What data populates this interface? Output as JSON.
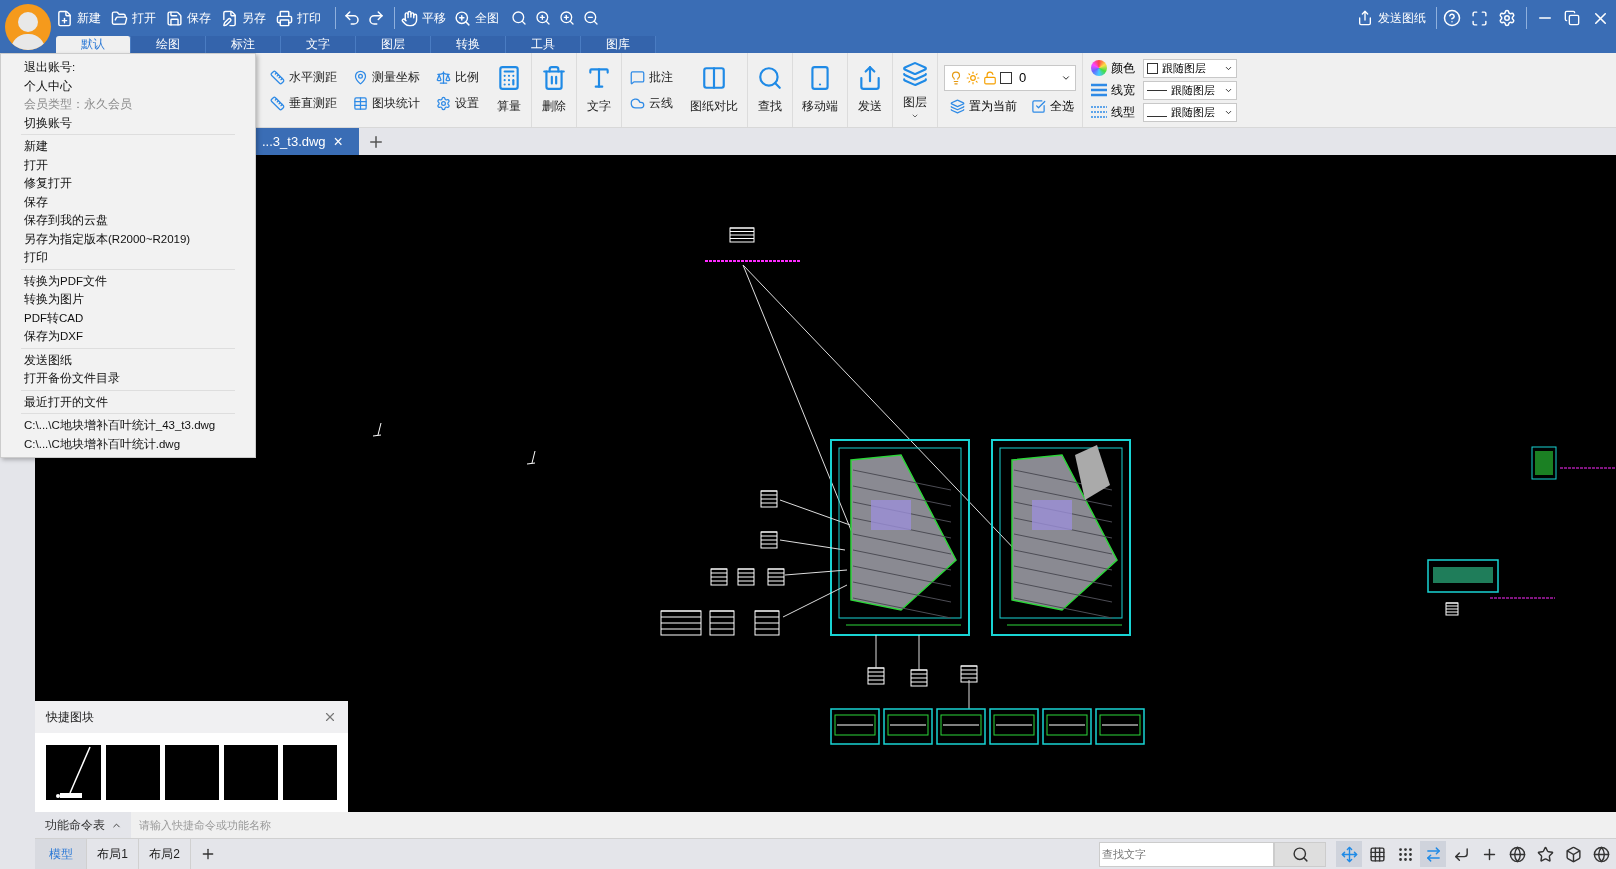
{
  "toolbar": {
    "actions": [
      {
        "label": "新建"
      },
      {
        "label": "打开"
      },
      {
        "label": "保存"
      },
      {
        "label": "另存"
      },
      {
        "label": "打印"
      }
    ],
    "view_actions": [
      {
        "label": "平移"
      },
      {
        "label": "全图"
      }
    ],
    "send_button": "发送图纸"
  },
  "ribbon_tabs": [
    {
      "label": "默认",
      "selected": true
    },
    {
      "label": "绘图",
      "selected": false
    },
    {
      "label": "标注",
      "selected": false
    },
    {
      "label": "文字",
      "selected": false
    },
    {
      "label": "图层",
      "selected": false
    },
    {
      "label": "转换",
      "selected": false
    },
    {
      "label": "工具",
      "selected": false
    },
    {
      "label": "图库",
      "selected": false
    }
  ],
  "ribbon": [
    {
      "kind": "pair",
      "items": [
        "水平测距",
        "垂直测距"
      ]
    },
    {
      "kind": "pair",
      "items": [
        "测量坐标",
        "图块统计"
      ]
    },
    {
      "kind": "pair",
      "items": [
        "比例",
        "设置"
      ]
    },
    {
      "kind": "large",
      "label": "算量"
    },
    {
      "kind": "large",
      "label": "删除"
    },
    {
      "kind": "large",
      "label": "文字"
    },
    {
      "kind": "pair",
      "items": [
        "批注",
        "云线"
      ]
    },
    {
      "kind": "large",
      "label": "图纸对比"
    },
    {
      "kind": "large",
      "label": "查找"
    },
    {
      "kind": "large",
      "label": "移动端"
    },
    {
      "kind": "large",
      "label": "发送"
    },
    {
      "kind": "large",
      "label": "图层"
    },
    {
      "kind": "layer",
      "value": "0",
      "actions": [
        "置为当前",
        "全选"
      ]
    },
    {
      "kind": "props",
      "items": [
        {
          "label": "颜色",
          "value": "跟随图层"
        },
        {
          "label": "线宽",
          "value": "跟随图层"
        },
        {
          "label": "线型",
          "value": "跟随图层"
        }
      ]
    }
  ],
  "file_menu": [
    [
      {
        "label": "退出账号:",
        "disabled": false
      },
      {
        "label": "个人中心",
        "disabled": false
      },
      {
        "label": "会员类型：永久会员",
        "disabled": true
      },
      {
        "label": "切换账号",
        "disabled": false
      }
    ],
    [
      {
        "label": "新建",
        "disabled": false
      },
      {
        "label": "打开",
        "disabled": false
      },
      {
        "label": "修复打开",
        "disabled": false
      },
      {
        "label": "保存",
        "disabled": false
      },
      {
        "label": "保存到我的云盘",
        "disabled": false
      },
      {
        "label": "另存为指定版本(R2000~R2019)",
        "disabled": false
      },
      {
        "label": "打印",
        "disabled": false
      }
    ],
    [
      {
        "label": "转换为PDF文件",
        "disabled": false
      },
      {
        "label": "转换为图片",
        "disabled": false
      },
      {
        "label": "PDF转CAD",
        "disabled": false
      },
      {
        "label": "保存为DXF",
        "disabled": false
      }
    ],
    [
      {
        "label": "发送图纸",
        "disabled": false
      },
      {
        "label": "打开备份文件目录",
        "disabled": false
      }
    ],
    [
      {
        "label": "最近打开的文件",
        "disabled": false
      }
    ],
    [
      {
        "label": "C:\\...\\C地块增补百叶统计_43_t3.dwg",
        "disabled": false
      },
      {
        "label": "C:\\...\\C地块增补百叶统计.dwg",
        "disabled": false
      }
    ]
  ],
  "document_tab": {
    "label": "...3_t3.dwg",
    "close": "×"
  },
  "quick_blocks": {
    "title": "快捷图块",
    "thumbnails": [
      {
        "kind": "crane"
      },
      {
        "kind": "blank"
      },
      {
        "kind": "blank"
      },
      {
        "kind": "blank"
      },
      {
        "kind": "blank"
      }
    ]
  },
  "command_bar": {
    "label": "功能命令表",
    "placeholder": "请输入快捷命令或功能名称"
  },
  "layout_tabs": [
    {
      "label": "模型",
      "selected": true
    },
    {
      "label": "布局1",
      "selected": false
    },
    {
      "label": "布局2",
      "selected": false
    }
  ],
  "search": {
    "placeholder": "查找文字"
  },
  "status_toggles": [
    {
      "on": true
    },
    {
      "on": false
    },
    {
      "on": false
    },
    {
      "on": true
    },
    {
      "on": false
    },
    {
      "on": false
    },
    {
      "on": false
    },
    {
      "on": false
    },
    {
      "on": false
    },
    {
      "on": false
    }
  ]
}
